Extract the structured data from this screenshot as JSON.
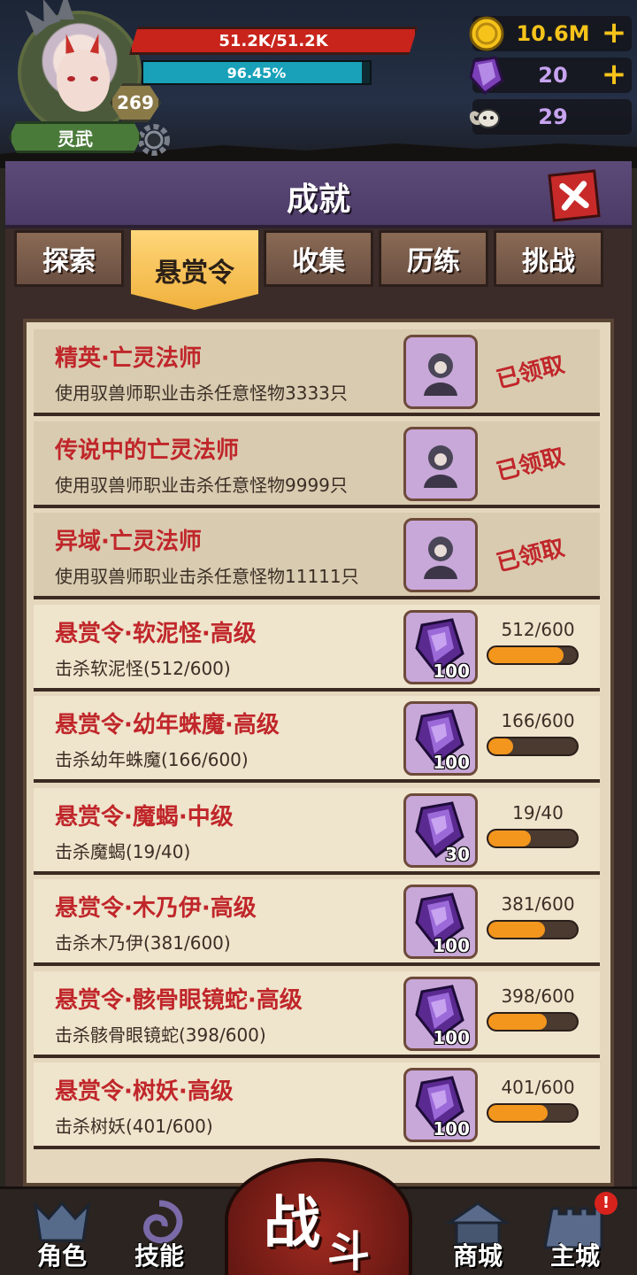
{
  "hud": {
    "player_name": "灵武",
    "level": "269",
    "hp_text": "51.2K/51.2K",
    "exp_text": "96.45%",
    "exp_fraction": 0.9645,
    "gold": "10.6M",
    "gems": "20",
    "skulls": "29"
  },
  "panel": {
    "title": "成就",
    "tabs": [
      "探索",
      "悬赏令",
      "收集",
      "历练",
      "挑战"
    ],
    "active_tab": 1
  },
  "achievements": [
    {
      "title": "精英·亡灵法师",
      "desc": "使用驭兽师职业击杀任意怪物3333只",
      "reward": "portrait",
      "status": "已领取"
    },
    {
      "title": "传说中的亡灵法师",
      "desc": "使用驭兽师职业击杀任意怪物9999只",
      "reward": "portrait",
      "status": "已领取"
    },
    {
      "title": "异域·亡灵法师",
      "desc": "使用驭兽师职业击杀任意怪物11111只",
      "reward": "portrait",
      "status": "已领取"
    },
    {
      "title": "悬赏令·软泥怪·高级",
      "desc": "击杀软泥怪(512/600)",
      "reward": "gem",
      "reward_count": "100",
      "progress_text": "512/600",
      "progress": 0.853
    },
    {
      "title": "悬赏令·幼年蛛魔·高级",
      "desc": "击杀幼年蛛魔(166/600)",
      "reward": "gem",
      "reward_count": "100",
      "progress_text": "166/600",
      "progress": 0.277
    },
    {
      "title": "悬赏令·魔蝎·中级",
      "desc": "击杀魔蝎(19/40)",
      "reward": "gem",
      "reward_count": "30",
      "progress_text": "19/40",
      "progress": 0.475
    },
    {
      "title": "悬赏令·木乃伊·高级",
      "desc": "击杀木乃伊(381/600)",
      "reward": "gem",
      "reward_count": "100",
      "progress_text": "381/600",
      "progress": 0.635
    },
    {
      "title": "悬赏令·骸骨眼镜蛇·高级",
      "desc": "击杀骸骨眼镜蛇(398/600)",
      "reward": "gem",
      "reward_count": "100",
      "progress_text": "398/600",
      "progress": 0.663
    },
    {
      "title": "悬赏令·树妖·高级",
      "desc": "击杀树妖(401/600)",
      "reward": "gem",
      "reward_count": "100",
      "progress_text": "401/600",
      "progress": 0.668
    }
  ],
  "nav": {
    "role": "角色",
    "skill": "技能",
    "battle_1": "战",
    "battle_2": "斗",
    "shop": "商城",
    "city": "主城",
    "alert": "!"
  },
  "colors": {
    "accent_red": "#c0262a",
    "progress_orange": "#f3961e",
    "gold_yellow": "#f5c31a",
    "gem_purple": "#7b3fb8"
  }
}
